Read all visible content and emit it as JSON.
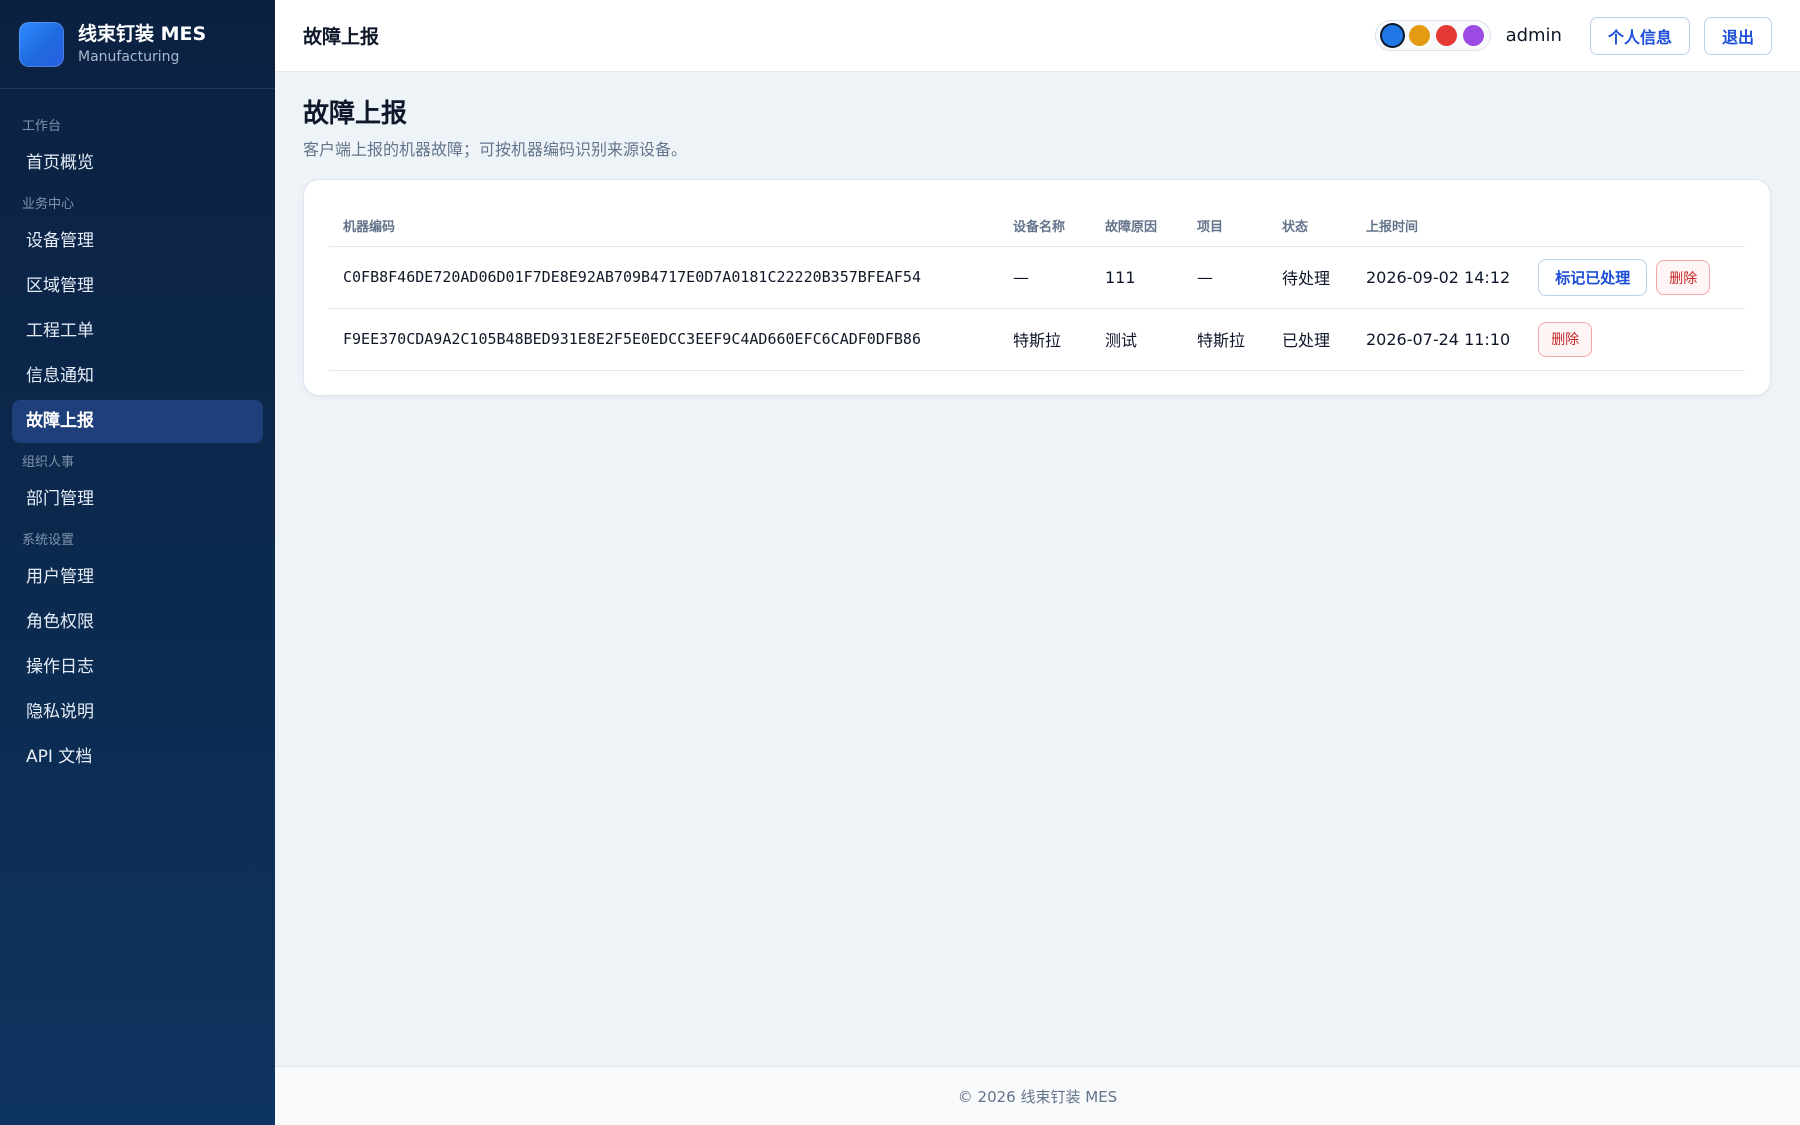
{
  "brand": {
    "name": "线束钉装 MES",
    "subtitle": "Manufacturing"
  },
  "sidebar": {
    "groups": [
      {
        "label": "工作台",
        "items": [
          {
            "label": "首页概览"
          }
        ]
      },
      {
        "label": "业务中心",
        "items": [
          {
            "label": "设备管理"
          },
          {
            "label": "区域管理"
          },
          {
            "label": "工程工单"
          },
          {
            "label": "信息通知"
          },
          {
            "label": "故障上报",
            "active": true
          }
        ]
      },
      {
        "label": "组织人事",
        "items": [
          {
            "label": "部门管理"
          }
        ]
      },
      {
        "label": "系统设置",
        "items": [
          {
            "label": "用户管理"
          },
          {
            "label": "角色权限"
          },
          {
            "label": "操作日志"
          },
          {
            "label": "隐私说明"
          },
          {
            "label": "API 文档"
          }
        ]
      }
    ]
  },
  "header": {
    "title": "故障上报",
    "theme_colors": [
      "#1f78e6",
      "#e39b12",
      "#e53935",
      "#9b4ae3"
    ],
    "username": "admin",
    "profile_label": "个人信息",
    "logout_label": "退出"
  },
  "page": {
    "title": "故障上报",
    "description": "客户端上报的机器故障；可按机器编码识别来源设备。"
  },
  "table": {
    "columns": [
      "机器编码",
      "设备名称",
      "故障原因",
      "项目",
      "状态",
      "上报时间"
    ],
    "rows": [
      {
        "code": "C0FB8F46DE720AD06D01F7DE8E92AB709B4717E0D7A0181C22220B357BFEAF54",
        "device": "—",
        "reason": "111",
        "project": "—",
        "status": "待处理",
        "time": "2026-09-02 14:12",
        "mark_label": "标记已处理",
        "delete_label": "删除"
      },
      {
        "code": "F9EE370CDA9A2C105B48BED931E8E2F5E0EDCC3EEF9C4AD660EFC6CADF0DFB86",
        "device": "特斯拉",
        "reason": "测试",
        "project": "特斯拉",
        "status": "已处理",
        "time": "2026-07-24 11:10",
        "delete_label": "删除"
      }
    ]
  },
  "footer": {
    "text": "© 2026 线束钉装 MES"
  }
}
